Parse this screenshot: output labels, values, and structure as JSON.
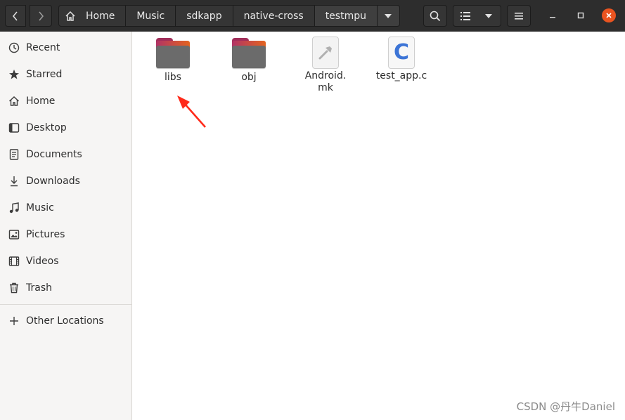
{
  "header": {
    "back_icon": "chevron-left-icon",
    "forward_icon": "chevron-right-icon",
    "home_icon": "home-icon",
    "breadcrumbs": [
      "Home",
      "Music",
      "sdkapp",
      "native-cross",
      "testmpu"
    ],
    "breadcrumb_dropdown_icon": "caret-down-icon",
    "search_icon": "search-icon",
    "view_icon": "list-view-icon",
    "view_dropdown_icon": "caret-down-icon",
    "menu_icon": "hamburger-menu-icon",
    "window_controls": [
      "minimize-icon",
      "maximize-icon",
      "close-icon"
    ],
    "close_color": "#e95420"
  },
  "sidebar": {
    "items": [
      {
        "label": "Recent",
        "icon": "clock-icon"
      },
      {
        "label": "Starred",
        "icon": "star-icon"
      },
      {
        "label": "Home",
        "icon": "home-icon"
      },
      {
        "label": "Desktop",
        "icon": "desktop-icon"
      },
      {
        "label": "Documents",
        "icon": "document-icon"
      },
      {
        "label": "Downloads",
        "icon": "download-icon"
      },
      {
        "label": "Music",
        "icon": "music-icon"
      },
      {
        "label": "Pictures",
        "icon": "picture-icon"
      },
      {
        "label": "Videos",
        "icon": "film-icon"
      },
      {
        "label": "Trash",
        "icon": "trash-icon"
      }
    ],
    "other_locations": {
      "label": "Other Locations",
      "icon": "plus-icon"
    }
  },
  "files": [
    {
      "name": "libs",
      "type": "folder"
    },
    {
      "name": "obj",
      "type": "folder"
    },
    {
      "name": "Android.\nmk",
      "type": "makefile",
      "icon": "hammer-icon"
    },
    {
      "name": "test_app.c",
      "type": "c-source",
      "glyph": "C"
    }
  ],
  "annotation": {
    "arrow_color": "#ff2a1a",
    "target": "libs"
  },
  "watermark": "CSDN @丹牛Daniel"
}
